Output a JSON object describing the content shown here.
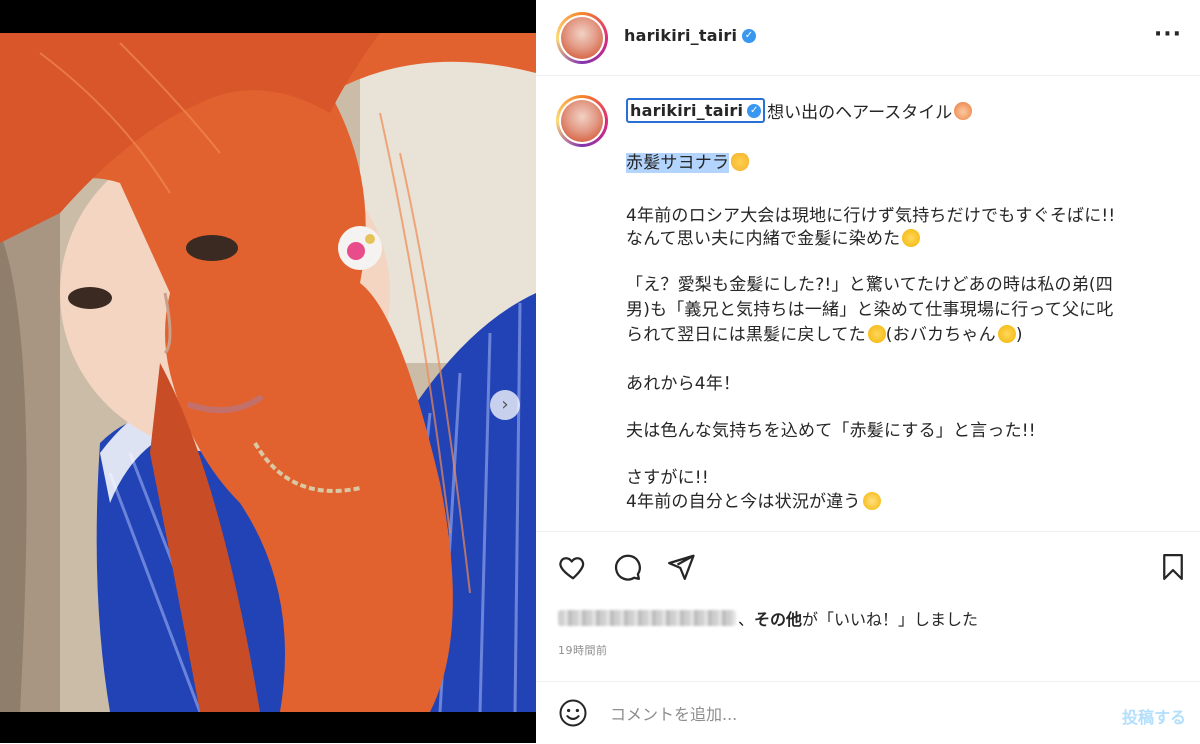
{
  "post": {
    "username": "harikiri_tairi",
    "verified_icon": "verified-badge-icon",
    "more_icon": "more-options-icon"
  },
  "caption": {
    "first_line": "想い出のヘアースタイル",
    "highlighted": "赤髪サヨナラ",
    "lines": [
      "4年前のロシア大会は現地に行けず気持ちだけでもすぐそばに!!",
      "なんて思い夫に内緒で金髪に染めた",
      "「え？愛梨も金髪にした?!」と驚いてたけどあの時は私の弟(四",
      "男)も「義兄と気持ちは一緒」と染めて仕事現場に行って父に叱",
      "られて翌日には黒髪に戻してた",
      "(おバカちゃん",
      ")",
      "あれから4年！",
      "夫は色んな気持ちを込めて「赤髪にする」と言った!!",
      "さすがに!!",
      "4年前の自分と今は状況が違う"
    ]
  },
  "actions": {
    "like_icon": "heart-icon",
    "comment_icon": "comment-icon",
    "share_icon": "share-icon",
    "save_icon": "bookmark-icon"
  },
  "likes": {
    "others_bold": "その他",
    "suffix_1": "が「いいね！」しました",
    "separator": "、"
  },
  "timestamp": "19時間前",
  "comment_box": {
    "placeholder": "コメントを追加...",
    "post_label": "投稿する",
    "emoji_icon": "smiley-icon"
  },
  "colors": {
    "accent": "#3897f0",
    "highlight": "#b3d4fc",
    "post_button_disabled": "#b2dffc",
    "muted_text": "#8e8e8e"
  }
}
